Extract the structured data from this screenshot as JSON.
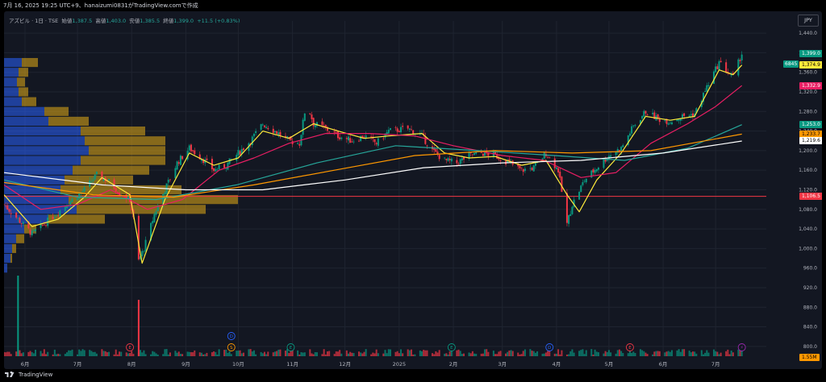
{
  "header": {
    "caption": "7月 16, 2025 19:25 UTC+9、hanaizumi0831がTradingView.comで作成",
    "symbol_line": "アズビル · 1日 · TSE",
    "open_label": "始値",
    "open_value": "1,387.5",
    "high_label": "高値",
    "high_value": "1,403.0",
    "low_label": "安値",
    "low_value": "1,385.5",
    "close_label": "終値",
    "close_value": "1,399.0",
    "change": "+11.5 (+0.83%)",
    "currency": "JPY"
  },
  "footer": {
    "brand": "TradingView"
  },
  "colors": {
    "background": "#131722",
    "up": "#089981",
    "down": "#f23645",
    "ma_short": "#ffeb3b",
    "ma_25": "#e91e63",
    "ma_75": "#26a69a",
    "ma_100": "#ff9800",
    "ma_200": "#ffffff",
    "vp_blue": "#2962ff",
    "vp_gold": "#d4a017",
    "hline": "#f23645"
  },
  "price_tags": [
    {
      "label": "1,399.0",
      "value": 1399,
      "bg": "#089981",
      "fg": "#ffffff"
    },
    {
      "label": "1,374.9",
      "value": 1374.9,
      "bg": "#ffeb3b",
      "fg": "#000000"
    },
    {
      "label": "1,332.9",
      "value": 1332.9,
      "bg": "#e91e63",
      "fg": "#ffffff"
    },
    {
      "label": "1,253.0",
      "value": 1253,
      "bg": "#089981",
      "fg": "#ffffff"
    },
    {
      "label": "1,233.7",
      "value": 1233.7,
      "bg": "#ff9800",
      "fg": "#000000"
    },
    {
      "label": "1,219.6",
      "value": 1219.6,
      "bg": "#ffffff",
      "fg": "#000000"
    },
    {
      "label": "1,106.5",
      "value": 1106.5,
      "bg": "#f23645",
      "fg": "#ffffff"
    },
    {
      "label": "1.55M",
      "value": 778,
      "bg": "#ff9800",
      "fg": "#000000"
    }
  ],
  "symbol_tag": "6845",
  "event_markers": [
    {
      "label": "E",
      "date": "2024-07-31",
      "color": "#f23645",
      "row": "low"
    },
    {
      "label": "D",
      "date": "2024-09-27",
      "color": "#2962ff",
      "row": "high"
    },
    {
      "label": "S",
      "date": "2024-09-27",
      "color": "#ff9800",
      "row": "low"
    },
    {
      "label": "E",
      "date": "2024-10-31",
      "color": "#089981",
      "row": "low"
    },
    {
      "label": "E",
      "date": "2025-01-31",
      "color": "#089981",
      "row": "low"
    },
    {
      "label": "D",
      "date": "2025-03-28",
      "color": "#2962ff",
      "row": "low"
    },
    {
      "label": "E",
      "date": "2025-05-13",
      "color": "#f23645",
      "row": "low"
    },
    {
      "label": "⚡",
      "date": "2025-07-16",
      "color": "#9c27b0",
      "row": "low"
    }
  ],
  "chart_data": {
    "type": "line",
    "ylim": [
      780,
      1455
    ],
    "y_ticks": [
      1440,
      1400,
      1360,
      1320,
      1280,
      1240,
      1200,
      1160,
      1120,
      1080,
      1040,
      1000,
      960,
      920,
      880,
      840,
      800
    ],
    "y_tick_labels": [
      "1,440.0",
      "1,400.0",
      "1,360.0",
      "1,320.0",
      "1,280.0",
      "1,240.0",
      "1,200.0",
      "1,160.0",
      "1,120.0",
      "1,080.0",
      "1,040.0",
      "1,000.0",
      "960.0",
      "920.0",
      "880.0",
      "840.0",
      "800.0"
    ],
    "x_range": [
      "2024-05-20",
      "2025-07-30"
    ],
    "x_ticks": [
      {
        "label": "6月",
        "date": "2024-06-01"
      },
      {
        "label": "7月",
        "date": "2024-07-01"
      },
      {
        "label": "8月",
        "date": "2024-08-01"
      },
      {
        "label": "9月",
        "date": "2024-09-01"
      },
      {
        "label": "10月",
        "date": "2024-10-01"
      },
      {
        "label": "11月",
        "date": "2024-11-01"
      },
      {
        "label": "12月",
        "date": "2024-12-01"
      },
      {
        "label": "2025",
        "date": "2025-01-01"
      },
      {
        "label": "2月",
        "date": "2025-02-01"
      },
      {
        "label": "3月",
        "date": "2025-03-01"
      },
      {
        "label": "4月",
        "date": "2025-04-01"
      },
      {
        "label": "5月",
        "date": "2025-05-01"
      },
      {
        "label": "6月",
        "date": "2025-06-01"
      },
      {
        "label": "7月",
        "date": "2025-07-01"
      }
    ],
    "price_path": [
      [
        "2024-05-20",
        1090
      ],
      [
        "2024-05-28",
        1060
      ],
      [
        "2024-06-05",
        1030
      ],
      [
        "2024-06-12",
        1050
      ],
      [
        "2024-06-20",
        1075
      ],
      [
        "2024-06-28",
        1100
      ],
      [
        "2024-07-05",
        1120
      ],
      [
        "2024-07-12",
        1150
      ],
      [
        "2024-07-18",
        1140
      ],
      [
        "2024-07-25",
        1115
      ],
      [
        "2024-07-31",
        1100
      ],
      [
        "2024-08-02",
        1060
      ],
      [
        "2024-08-05",
        975
      ],
      [
        "2024-08-08",
        1000
      ],
      [
        "2024-08-14",
        1070
      ],
      [
        "2024-08-20",
        1120
      ],
      [
        "2024-08-27",
        1175
      ],
      [
        "2024-09-03",
        1205
      ],
      [
        "2024-09-10",
        1185
      ],
      [
        "2024-09-17",
        1160
      ],
      [
        "2024-09-24",
        1170
      ],
      [
        "2024-10-01",
        1195
      ],
      [
        "2024-10-08",
        1220
      ],
      [
        "2024-10-15",
        1255
      ],
      [
        "2024-10-22",
        1240
      ],
      [
        "2024-10-30",
        1220
      ],
      [
        "2024-11-05",
        1215
      ],
      [
        "2024-11-09",
        1300
      ],
      [
        "2024-11-13",
        1255
      ],
      [
        "2024-11-20",
        1245
      ],
      [
        "2024-11-27",
        1230
      ],
      [
        "2024-12-05",
        1220
      ],
      [
        "2024-12-12",
        1230
      ],
      [
        "2024-12-19",
        1215
      ],
      [
        "2024-12-26",
        1240
      ],
      [
        "2025-01-06",
        1245
      ],
      [
        "2025-01-14",
        1230
      ],
      [
        "2025-01-20",
        1200
      ],
      [
        "2025-01-27",
        1180
      ],
      [
        "2025-02-03",
        1175
      ],
      [
        "2025-02-10",
        1190
      ],
      [
        "2025-02-17",
        1195
      ],
      [
        "2025-02-25",
        1190
      ],
      [
        "2025-03-05",
        1175
      ],
      [
        "2025-03-12",
        1160
      ],
      [
        "2025-03-19",
        1165
      ],
      [
        "2025-03-26",
        1195
      ],
      [
        "2025-04-02",
        1160
      ],
      [
        "2025-04-07",
        1050
      ],
      [
        "2025-04-10",
        1090
      ],
      [
        "2025-04-17",
        1140
      ],
      [
        "2025-04-24",
        1165
      ],
      [
        "2025-05-01",
        1190
      ],
      [
        "2025-05-08",
        1205
      ],
      [
        "2025-05-15",
        1250
      ],
      [
        "2025-05-22",
        1280
      ],
      [
        "2025-05-29",
        1265
      ],
      [
        "2025-06-05",
        1260
      ],
      [
        "2025-06-12",
        1270
      ],
      [
        "2025-06-19",
        1275
      ],
      [
        "2025-06-26",
        1330
      ],
      [
        "2025-07-03",
        1380
      ],
      [
        "2025-07-08",
        1360
      ],
      [
        "2025-07-11",
        1350
      ],
      [
        "2025-07-16",
        1399
      ]
    ],
    "series": [
      {
        "color": "#ffeb3b",
        "values": [
          [
            "2024-05-20",
            1110
          ],
          [
            "2024-06-05",
            1045
          ],
          [
            "2024-06-20",
            1060
          ],
          [
            "2024-07-05",
            1105
          ],
          [
            "2024-07-15",
            1145
          ],
          [
            "2024-07-31",
            1110
          ],
          [
            "2024-08-07",
            970
          ],
          [
            "2024-08-20",
            1100
          ],
          [
            "2024-09-03",
            1195
          ],
          [
            "2024-09-17",
            1170
          ],
          [
            "2024-10-01",
            1185
          ],
          [
            "2024-10-15",
            1240
          ],
          [
            "2024-10-30",
            1225
          ],
          [
            "2024-11-13",
            1255
          ],
          [
            "2024-11-27",
            1240
          ],
          [
            "2024-12-12",
            1225
          ],
          [
            "2024-12-26",
            1230
          ],
          [
            "2025-01-14",
            1235
          ],
          [
            "2025-01-27",
            1195
          ],
          [
            "2025-02-10",
            1185
          ],
          [
            "2025-02-25",
            1188
          ],
          [
            "2025-03-12",
            1170
          ],
          [
            "2025-03-26",
            1180
          ],
          [
            "2025-04-07",
            1110
          ],
          [
            "2025-04-14",
            1075
          ],
          [
            "2025-04-24",
            1140
          ],
          [
            "2025-05-08",
            1195
          ],
          [
            "2025-05-22",
            1270
          ],
          [
            "2025-06-05",
            1262
          ],
          [
            "2025-06-19",
            1270
          ],
          [
            "2025-07-03",
            1365
          ],
          [
            "2025-07-11",
            1355
          ],
          [
            "2025-07-16",
            1374.9
          ]
        ]
      },
      {
        "color": "#e91e63",
        "values": [
          [
            "2024-05-20",
            1130
          ],
          [
            "2024-06-10",
            1080
          ],
          [
            "2024-07-01",
            1090
          ],
          [
            "2024-07-20",
            1120
          ],
          [
            "2024-08-10",
            1080
          ],
          [
            "2024-08-30",
            1100
          ],
          [
            "2024-09-20",
            1160
          ],
          [
            "2024-10-10",
            1185
          ],
          [
            "2024-10-30",
            1215
          ],
          [
            "2024-11-20",
            1235
          ],
          [
            "2024-12-15",
            1235
          ],
          [
            "2025-01-10",
            1230
          ],
          [
            "2025-02-01",
            1210
          ],
          [
            "2025-03-01",
            1190
          ],
          [
            "2025-03-25",
            1180
          ],
          [
            "2025-04-15",
            1145
          ],
          [
            "2025-05-05",
            1155
          ],
          [
            "2025-05-25",
            1215
          ],
          [
            "2025-06-15",
            1255
          ],
          [
            "2025-07-01",
            1290
          ],
          [
            "2025-07-16",
            1332.9
          ]
        ]
      },
      {
        "color": "#26a69a",
        "values": [
          [
            "2024-05-20",
            1140
          ],
          [
            "2024-07-01",
            1105
          ],
          [
            "2024-08-15",
            1100
          ],
          [
            "2024-09-30",
            1130
          ],
          [
            "2024-11-15",
            1175
          ],
          [
            "2024-12-30",
            1210
          ],
          [
            "2025-02-15",
            1200
          ],
          [
            "2025-03-31",
            1190
          ],
          [
            "2025-05-10",
            1180
          ],
          [
            "2025-06-15",
            1205
          ],
          [
            "2025-07-16",
            1253
          ]
        ]
      },
      {
        "color": "#ff9800",
        "values": [
          [
            "2024-05-20",
            1135
          ],
          [
            "2024-07-10",
            1110
          ],
          [
            "2024-08-25",
            1105
          ],
          [
            "2024-10-10",
            1130
          ],
          [
            "2024-11-25",
            1160
          ],
          [
            "2025-01-10",
            1190
          ],
          [
            "2025-02-25",
            1200
          ],
          [
            "2025-04-10",
            1195
          ],
          [
            "2025-05-25",
            1200
          ],
          [
            "2025-07-16",
            1233.7
          ]
        ]
      },
      {
        "color": "#ffffff",
        "values": [
          [
            "2024-05-20",
            1155
          ],
          [
            "2024-07-15",
            1130
          ],
          [
            "2024-09-01",
            1120
          ],
          [
            "2024-10-15",
            1120
          ],
          [
            "2024-12-01",
            1140
          ],
          [
            "2025-01-15",
            1165
          ],
          [
            "2025-03-01",
            1175
          ],
          [
            "2025-04-15",
            1180
          ],
          [
            "2025-06-01",
            1195
          ],
          [
            "2025-07-16",
            1219.6
          ]
        ]
      }
    ],
    "hline": 1106.5,
    "volume_profile": [
      {
        "price": 1380,
        "up": 22,
        "down": 20
      },
      {
        "price": 1360,
        "up": 18,
        "down": 12
      },
      {
        "price": 1340,
        "up": 16,
        "down": 10
      },
      {
        "price": 1320,
        "up": 18,
        "down": 12
      },
      {
        "price": 1300,
        "up": 22,
        "down": 18
      },
      {
        "price": 1280,
        "up": 50,
        "down": 30
      },
      {
        "price": 1260,
        "up": 55,
        "down": 50
      },
      {
        "price": 1240,
        "up": 95,
        "down": 80
      },
      {
        "price": 1220,
        "up": 100,
        "down": 100
      },
      {
        "price": 1200,
        "up": 105,
        "down": 95
      },
      {
        "price": 1180,
        "up": 95,
        "down": 105
      },
      {
        "price": 1160,
        "up": 85,
        "down": 95
      },
      {
        "price": 1140,
        "up": 75,
        "down": 85
      },
      {
        "price": 1120,
        "up": 70,
        "down": 150
      },
      {
        "price": 1100,
        "up": 80,
        "down": 210
      },
      {
        "price": 1080,
        "up": 90,
        "down": 160
      },
      {
        "price": 1060,
        "up": 55,
        "down": 70
      },
      {
        "price": 1040,
        "up": 25,
        "down": 15
      },
      {
        "price": 1020,
        "up": 15,
        "down": 10
      },
      {
        "price": 1000,
        "up": 10,
        "down": 5
      },
      {
        "price": 980,
        "up": 8,
        "down": 2
      },
      {
        "price": 960,
        "up": 4,
        "down": 0
      }
    ],
    "volume_spikes": [
      {
        "date": "2024-05-28",
        "value": 1.0,
        "color": "#089981"
      },
      {
        "date": "2024-08-05",
        "value": 0.7,
        "color": "#f23645"
      }
    ]
  }
}
